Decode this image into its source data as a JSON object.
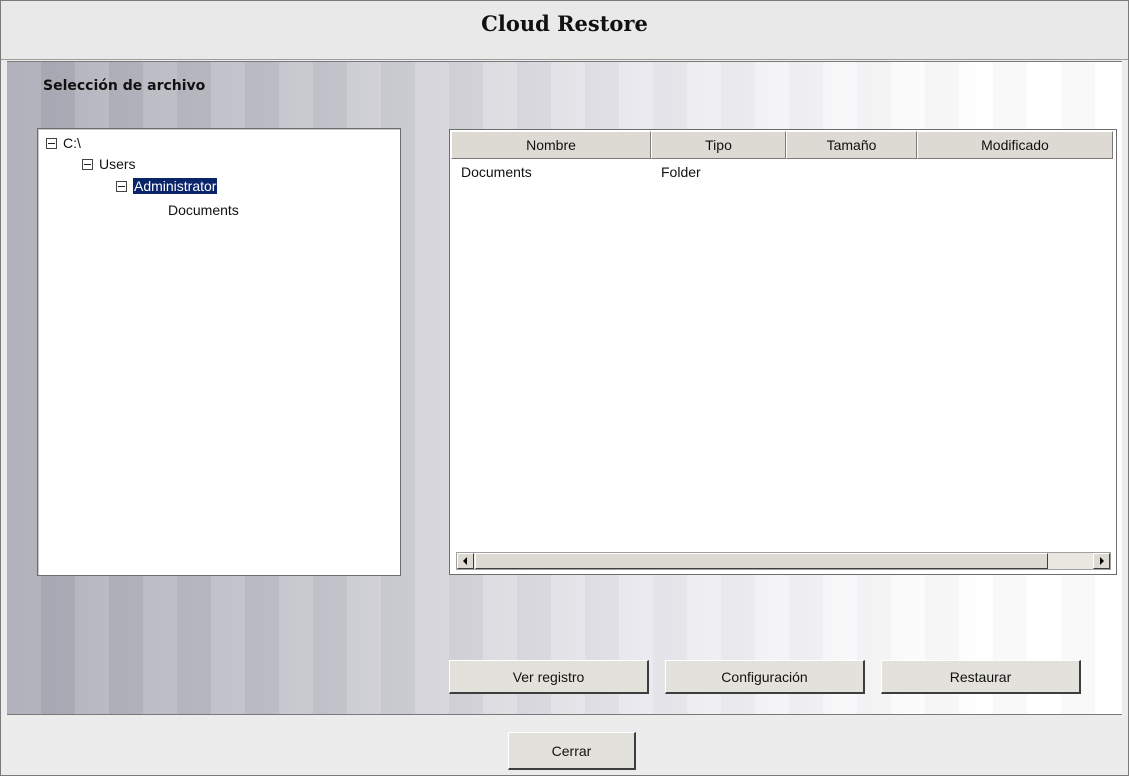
{
  "window": {
    "title": "Cloud Restore"
  },
  "file_selection": {
    "label": "Selección de archivo",
    "tree": [
      {
        "label": "C:\\",
        "expanded": true,
        "selected": false
      },
      {
        "label": "Users",
        "expanded": true,
        "selected": false
      },
      {
        "label": "Administrator",
        "expanded": true,
        "selected": true
      },
      {
        "label": "Documents",
        "expanded": false,
        "selected": false
      }
    ]
  },
  "file_list": {
    "columns": [
      "Nombre",
      "Tipo",
      "Tamaño",
      "Modificado"
    ],
    "rows": [
      {
        "name": "Documents",
        "type": "Folder",
        "size": "",
        "modified": ""
      }
    ]
  },
  "actions": {
    "view_log": "Ver registro",
    "settings": "Configuración",
    "restore": "Restaurar"
  },
  "footer": {
    "close": "Cerrar"
  },
  "colors": {
    "selection": "#0a246a",
    "button_face": "#e3e1db"
  }
}
